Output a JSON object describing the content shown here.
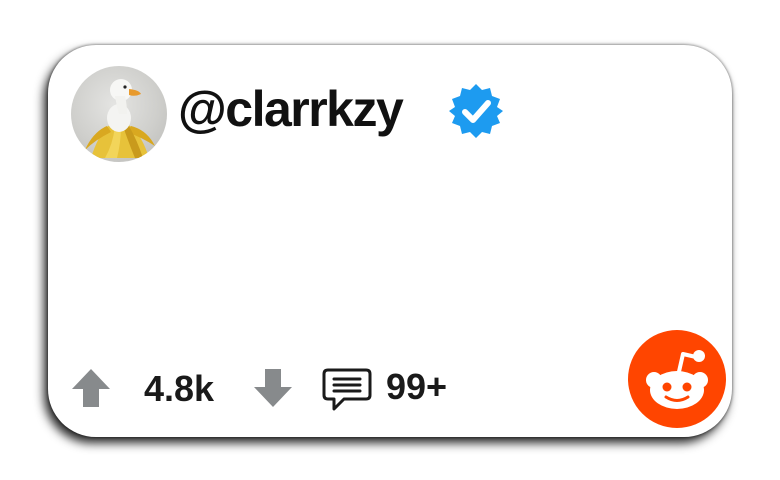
{
  "post": {
    "username": "@clarrkzy",
    "verified": true,
    "avatar_icon": "banana-duck-avatar",
    "upvotes": "4.8k",
    "comment_count": "99+"
  },
  "icons": {
    "verified": "verified-badge-icon",
    "upvote": "upvote-arrow-icon",
    "downvote": "downvote-arrow-icon",
    "comment": "comment-bubble-icon",
    "brand": "reddit-logo-icon"
  },
  "colors": {
    "verified_blue": "#1d9bf0",
    "reddit_orange": "#ff4500",
    "vote_gray": "#878a8c",
    "text": "#1a1a1a"
  }
}
